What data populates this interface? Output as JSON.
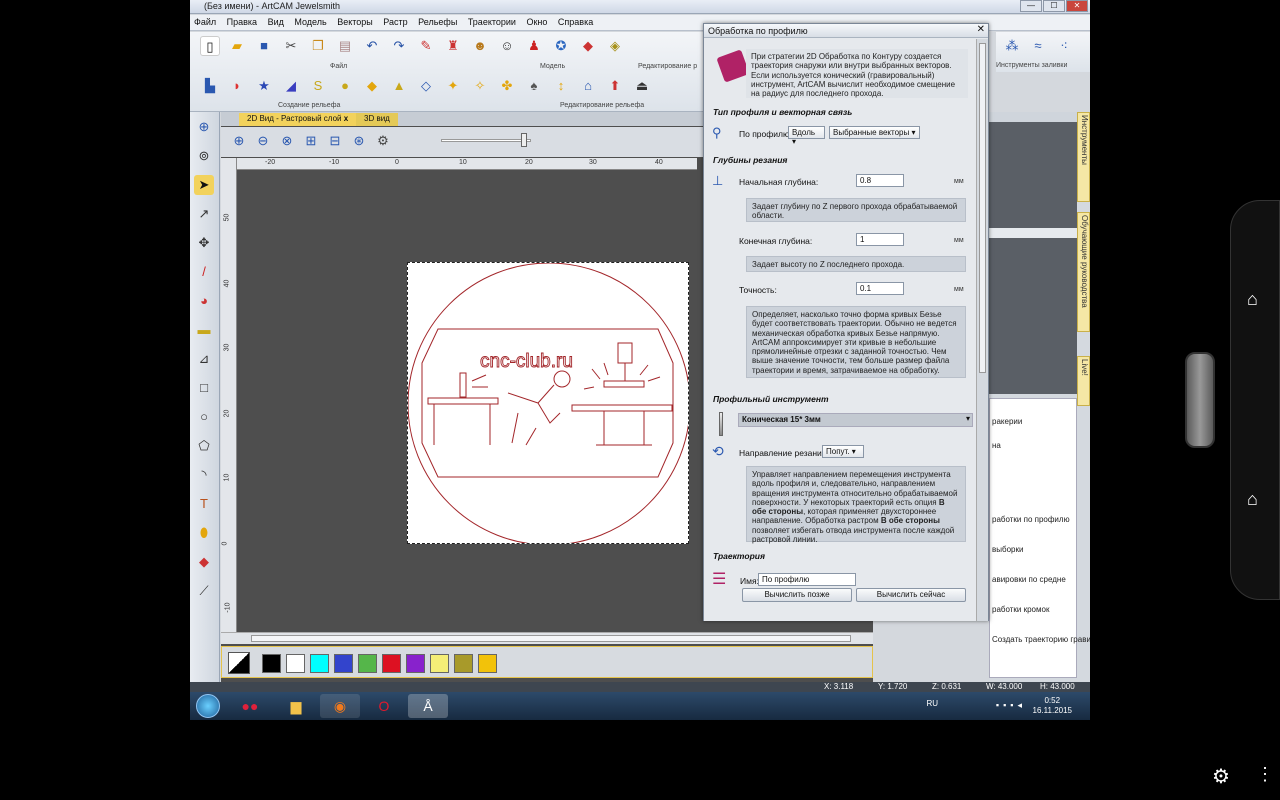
{
  "window": {
    "title": "(Без имени) - ArtCAM Jewelsmith",
    "minimize": "—",
    "maximize": "☐",
    "close": "✕"
  },
  "menu": [
    "Файл",
    "Правка",
    "Вид",
    "Модель",
    "Векторы",
    "Растр",
    "Рельефы",
    "Траектории",
    "Окно",
    "Справка"
  ],
  "ribbon": {
    "groups": [
      "Файл",
      "Модель",
      "Редактирование р",
      "Создание рельефа",
      "Редактирование рельефа",
      "Инструменты заливки"
    ]
  },
  "view": {
    "tab_2d": "2D Вид - Растровый слой",
    "tab_3d": "3D вид",
    "tab_close": "x",
    "ruler_h": [
      "-20",
      "-10",
      "0",
      "10",
      "20",
      "30",
      "40"
    ],
    "ruler_v": [
      "50",
      "40",
      "30",
      "20",
      "10",
      "0",
      "-10"
    ],
    "canvas_text": "cnc-club.ru"
  },
  "palette": {
    "colors": [
      "#000000",
      "#ffffff",
      "#00ffff",
      "#3344cc",
      "#55b64a",
      "#dd1122",
      "#8822cc",
      "#f5ee77",
      "#a89a2a",
      "#f2c20a"
    ]
  },
  "status": {
    "x": "X: 3.118",
    "y": "Y: 1.720",
    "z": "Z: 0.631",
    "w": "W: 43.000",
    "h": "H: 43.000"
  },
  "taskbar": {
    "lang": "RU",
    "time": "0:52",
    "date": "16.11.2015"
  },
  "dialog": {
    "title": "Обработка по профилю",
    "close": "✕",
    "intro": "При стратегии 2D Обработка по Контуру создается траектория снаружи или внутри выбранных векторов. Если используется конический (гравировальный) инструмент, ArtCAM вычислит необходимое смещение на радиус для последнего прохода.",
    "section_profile": "Тип профиля и векторная связь",
    "profile_label": "По профилю",
    "profile_mode": "Вдоль",
    "profile_vectors": "Выбранные векторы",
    "section_depth": "Глубины резания",
    "start_depth_label": "Начальная глубина:",
    "start_depth_value": "0.8",
    "start_depth_unit": "мм",
    "start_depth_desc": "Задает глубину по Z первого прохода обрабатываемой области.",
    "end_depth_label": "Конечная глубина:",
    "end_depth_value": "1",
    "end_depth_unit": "мм",
    "end_depth_desc": "Задает высоту по Z последнего прохода.",
    "tolerance_label": "Точность:",
    "tolerance_value": "0.1",
    "tolerance_unit": "мм",
    "tolerance_desc": "Определяет, насколько точно форма кривых Безье будет соответствовать траектории. Обычно не ведется механическая обработка кривых Безье напрямую. ArtCAM аппроксимирует эти кривые в небольшие прямолинейные отрезки с заданной точностью. Чем выше значение точности, тем больше размер файла траектории и время, затрачиваемое на обработку.",
    "section_tool": "Профильный инструмент",
    "tool_name": "Коническая 15* 3мм",
    "direction_label": "Направление резания:",
    "direction_value": "Попут.",
    "direction_desc_1": "Управляет направлением перемещения инструмента вдоль профиля и, следовательно, направлением вращения инструмента относительно обрабатываемой поверхности. У некоторых траекторий есть опция",
    "direction_desc_bold_1": "В обе стороны",
    "direction_desc_2": ", которая применяет двухстороннее направление. Обработка растром",
    "direction_desc_bold_2": "В обе стороны",
    "direction_desc_3": "позволяет избегать отвода инструмента после каждой растровой линии.",
    "section_toolpath": "Траектория",
    "name_label": "Имя:",
    "name_value": "По профилю",
    "btn_later": "Вычислить позже",
    "btn_now": "Вычислить сейчас"
  },
  "dock": {
    "vert_tools": "Инструменты",
    "vert_tutorials": "Обучающие руководства",
    "vert_live": "Live!",
    "list": [
      "ракерии",
      "на",
      "работки по профилю",
      "выборки",
      "авировки по средне",
      "работки кромок",
      "Создать траекторию гравировки"
    ]
  }
}
